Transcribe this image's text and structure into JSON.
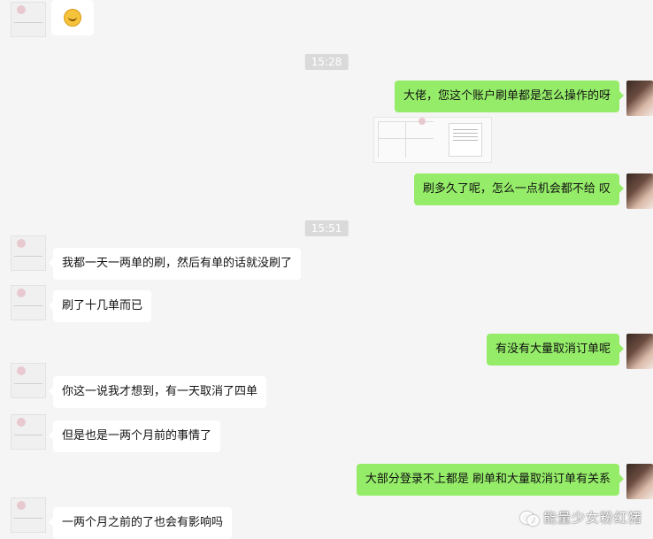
{
  "timestamps": [
    "15:28",
    "15:51"
  ],
  "messages": {
    "m1": "大佬，您这个账户刷单都是怎么操作的呀",
    "m2": "刷多久了呢，怎么一点机会都不给  叹",
    "m3": "我都一天一两单的刷，然后有单的话就没刷了",
    "m4": "刷了十几单而已",
    "m5": "有没有大量取消订单呢",
    "m6": "你这一说我才想到，有一天取消了四单",
    "m7": "但是也是一两个月前的事情了",
    "m8": "大部分登录不上都是 刷单和大量取消订单有关系",
    "m9": "一两个月之前的了也会有影响吗"
  },
  "watermark": "能量少女粉红猪",
  "colors": {
    "right_bubble": "#95ec69",
    "left_bubble": "#ffffff",
    "background": "#f5f5f5"
  }
}
